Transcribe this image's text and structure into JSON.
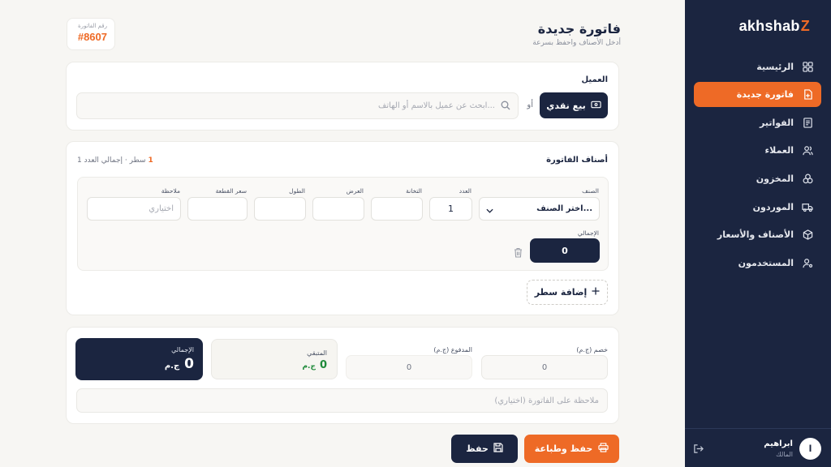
{
  "brand": {
    "name": "akhshab",
    "mark": "Z"
  },
  "sidebar": {
    "items": [
      {
        "label": "الرئيسية",
        "icon": "dashboard-icon"
      },
      {
        "label": "فاتورة جديدة",
        "icon": "new-invoice-icon",
        "active": true
      },
      {
        "label": "الفواتير",
        "icon": "invoices-icon"
      },
      {
        "label": "العملاء",
        "icon": "customers-icon"
      },
      {
        "label": "المخزون",
        "icon": "inventory-icon"
      },
      {
        "label": "الموردون",
        "icon": "truck-icon"
      },
      {
        "label": "الأصناف والأسعار",
        "icon": "box-icon"
      },
      {
        "label": "المستخدمون",
        "icon": "users-settings-icon"
      }
    ],
    "user": {
      "initial": "ا",
      "name": "ابراهيم",
      "role": "المالك"
    }
  },
  "header": {
    "title": "فاتورة جديدة",
    "subtitle": "أدخل الأصناف واحفظ بسرعة",
    "invoice_label": "رقم الفاتورة",
    "invoice_number": "#8607"
  },
  "customer": {
    "title": "العميل",
    "cash_button": "بيع نقدي",
    "or": "أو",
    "search_placeholder": "ابحث عن عميل بالاسم أو الهاتف..."
  },
  "items": {
    "title": "أصناف الفاتورة",
    "summary_prefix": "1 سطر · إجمالي العدد",
    "summary_count": "1",
    "labels": {
      "item": "الصنف",
      "qty": "العدد",
      "thickness": "التخانة",
      "width": "العرض",
      "length": "الطول",
      "price": "سعر القطعة",
      "note": "ملاحظة",
      "total": "الإجمالي"
    },
    "row": {
      "item_placeholder": "اختر الصنف...",
      "qty": "1",
      "note_placeholder": "اختياري",
      "total": "0"
    },
    "add_row": "إضافة سطر"
  },
  "totals": {
    "discount_label": "خصم (ج.م)",
    "discount_value": "0",
    "paid_label": "المدفوع (ج.م)",
    "paid_value": "0",
    "remaining_label": "المتبقي",
    "remaining_value": "0",
    "total_label": "الإجمالي",
    "total_value": "0",
    "currency": "ج.م",
    "note_placeholder": "ملاحظة على الفاتورة (اختياري)"
  },
  "actions": {
    "save_print": "حفظ وطباعة",
    "save": "حفظ"
  },
  "colors": {
    "accent": "#ee6a26",
    "navy": "#1b2540",
    "success": "#1f8a3a"
  }
}
